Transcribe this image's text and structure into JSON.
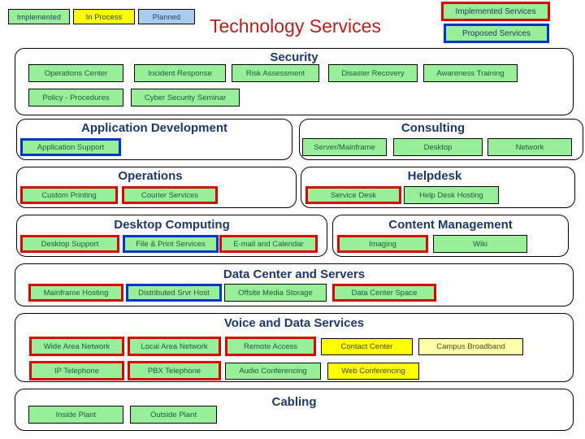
{
  "page": {
    "title": "Technology Services",
    "title_color": "#b52020"
  },
  "legend": {
    "items": [
      {
        "label": "Implemented",
        "color": "#99ee99"
      },
      {
        "label": "In Process",
        "color": "#ffff00"
      },
      {
        "label": "Planned",
        "color": "#aaccf2"
      }
    ]
  },
  "status_keys": [
    {
      "label": "Implemented Services",
      "border_color": "#dd0000"
    },
    {
      "label": "Proposed Services",
      "border_color": "#0033cc"
    }
  ],
  "sections": [
    {
      "title": "Security",
      "items": [
        {
          "label": "Operations Center",
          "fill": "green",
          "border": "thin"
        },
        {
          "label": "Incident Response",
          "fill": "green",
          "border": "thin"
        },
        {
          "label": "Risk Assessment",
          "fill": "green",
          "border": "thin"
        },
        {
          "label": "Disaster Recovery",
          "fill": "green",
          "border": "thin"
        },
        {
          "label": "Awareness Training",
          "fill": "green",
          "border": "thin"
        },
        {
          "label": "Policy - Procedures",
          "fill": "green",
          "border": "thin"
        },
        {
          "label": "Cyber Security Seminar",
          "fill": "green",
          "border": "thin"
        }
      ]
    },
    {
      "title": "Application Development",
      "items": [
        {
          "label": "Application Support",
          "fill": "green",
          "border": "blue"
        }
      ]
    },
    {
      "title": "Consulting",
      "items": [
        {
          "label": "Server/Mainframe",
          "fill": "green",
          "border": "thin"
        },
        {
          "label": "Desktop",
          "fill": "green",
          "border": "thin"
        },
        {
          "label": "Network",
          "fill": "green",
          "border": "thin"
        }
      ]
    },
    {
      "title": "Operations",
      "items": [
        {
          "label": "Custom Printing",
          "fill": "green",
          "border": "red"
        },
        {
          "label": "Courier Services",
          "fill": "green",
          "border": "red"
        }
      ]
    },
    {
      "title": "Helpdesk",
      "items": [
        {
          "label": "Service Desk",
          "fill": "green",
          "border": "red"
        },
        {
          "label": "Help Desk Hosting",
          "fill": "green",
          "border": "thin"
        }
      ]
    },
    {
      "title": "Desktop Computing",
      "items": [
        {
          "label": "Desktop Support",
          "fill": "green",
          "border": "red"
        },
        {
          "label": "File & Print Services",
          "fill": "green",
          "border": "blue"
        },
        {
          "label": "E-mail and Calendar",
          "fill": "green",
          "border": "red"
        }
      ]
    },
    {
      "title": "Content  Management",
      "items": [
        {
          "label": "Imaging",
          "fill": "green",
          "border": "red"
        },
        {
          "label": "Wiki",
          "fill": "green",
          "border": "thin"
        }
      ]
    },
    {
      "title": "Data Center and Servers",
      "items": [
        {
          "label": "Mainframe Hosting",
          "fill": "green",
          "border": "red"
        },
        {
          "label": "Distributed Srvr Host",
          "fill": "green",
          "border": "blue"
        },
        {
          "label": "Offsite Media Storage",
          "fill": "green",
          "border": "thin"
        },
        {
          "label": "Data Center Space",
          "fill": "green",
          "border": "red"
        }
      ]
    },
    {
      "title": "Voice and Data Services",
      "items": [
        {
          "label": "Wide Area Network",
          "fill": "green",
          "border": "red"
        },
        {
          "label": "Local Area Network",
          "fill": "green",
          "border": "red"
        },
        {
          "label": "Remote Access",
          "fill": "green",
          "border": "red"
        },
        {
          "label": "Contact Center",
          "fill": "yellow",
          "border": "thin"
        },
        {
          "label": "Campus Broadband",
          "fill": "lyellow",
          "border": "thin"
        },
        {
          "label": "IP Telephone",
          "fill": "green",
          "border": "red"
        },
        {
          "label": "PBX Telephone",
          "fill": "green",
          "border": "red"
        },
        {
          "label": "Audio Conferencing",
          "fill": "green",
          "border": "thin"
        },
        {
          "label": "Web Conferencing",
          "fill": "yellow",
          "border": "thin"
        }
      ]
    },
    {
      "title": "Cabling",
      "items": [
        {
          "label": "Inside Plant",
          "fill": "green",
          "border": "thin"
        },
        {
          "label": "Outside Plant",
          "fill": "green",
          "border": "thin"
        }
      ]
    }
  ]
}
